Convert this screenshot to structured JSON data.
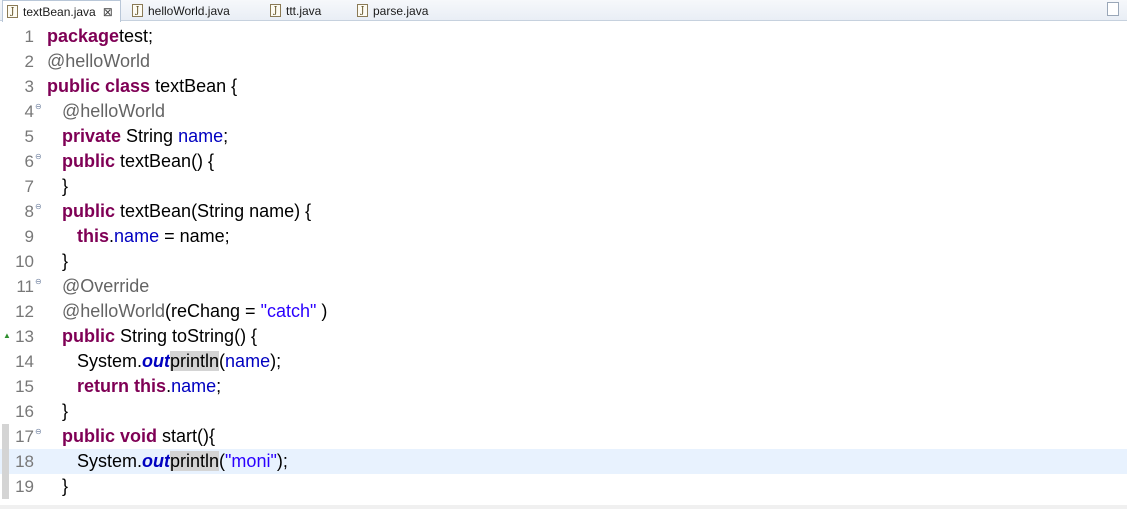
{
  "tabs": [
    {
      "label": "textBean.java",
      "active": true,
      "close": "⊠"
    },
    {
      "label": "helloWorld.java"
    },
    {
      "label": "ttt.java"
    },
    {
      "label": "parse.java"
    }
  ],
  "lines": [
    {
      "n": "1",
      "tokens": [
        [
          "kw",
          "package"
        ],
        [
          "",
          "test;"
        ]
      ]
    },
    {
      "n": "2",
      "tokens": [
        [
          "an",
          "@helloWorld"
        ]
      ]
    },
    {
      "n": "3",
      "tokens": [
        [
          "kw",
          "public"
        ],
        [
          "",
          " "
        ],
        [
          "kw",
          "class"
        ],
        [
          "",
          " textBean {"
        ]
      ]
    },
    {
      "n": "4",
      "fold": true,
      "tokens": [
        [
          "",
          "   "
        ],
        [
          "an",
          "@helloWorld"
        ]
      ]
    },
    {
      "n": "5",
      "tokens": [
        [
          "",
          "   "
        ],
        [
          "kw",
          "private"
        ],
        [
          "",
          " String "
        ],
        [
          "fld",
          "name"
        ],
        [
          "",
          ";"
        ]
      ]
    },
    {
      "n": "6",
      "fold": true,
      "tokens": [
        [
          "",
          "   "
        ],
        [
          "kw",
          "public"
        ],
        [
          "",
          " textBean() {"
        ]
      ]
    },
    {
      "n": "7",
      "tokens": [
        [
          "",
          "   }"
        ]
      ]
    },
    {
      "n": "8",
      "fold": true,
      "tokens": [
        [
          "",
          "   "
        ],
        [
          "kw",
          "public"
        ],
        [
          "",
          " textBean(String name) {"
        ]
      ]
    },
    {
      "n": "9",
      "tokens": [
        [
          "",
          "      "
        ],
        [
          "kw",
          "this"
        ],
        [
          "",
          "."
        ],
        [
          "fld",
          "name"
        ],
        [
          "",
          " = name;"
        ]
      ]
    },
    {
      "n": "10",
      "tokens": [
        [
          "",
          "   }"
        ]
      ]
    },
    {
      "n": "11",
      "fold": true,
      "tokens": [
        [
          "",
          "   "
        ],
        [
          "an",
          "@Override"
        ]
      ]
    },
    {
      "n": "12",
      "tokens": [
        [
          "",
          "   "
        ],
        [
          "an",
          "@helloWorld"
        ],
        [
          "",
          "(reChang = "
        ],
        [
          "str",
          "\"catch\""
        ],
        [
          "",
          " )"
        ]
      ]
    },
    {
      "n": "13",
      "override": true,
      "tokens": [
        [
          "",
          "   "
        ],
        [
          "kw",
          "public"
        ],
        [
          "",
          " String toString() {"
        ]
      ]
    },
    {
      "n": "14",
      "tokens": [
        [
          "",
          "      System."
        ],
        [
          "sf",
          "out"
        ],
        [
          "occ",
          "println"
        ],
        [
          "",
          "("
        ],
        [
          "fld",
          "name"
        ],
        [
          "",
          ");"
        ]
      ]
    },
    {
      "n": "15",
      "tokens": [
        [
          "",
          "      "
        ],
        [
          "kw",
          "return"
        ],
        [
          "",
          " "
        ],
        [
          "kw",
          "this"
        ],
        [
          "",
          "."
        ],
        [
          "fld",
          "name"
        ],
        [
          "",
          ";"
        ]
      ]
    },
    {
      "n": "16",
      "tokens": [
        [
          "",
          "   }"
        ]
      ]
    },
    {
      "n": "17",
      "fold": true,
      "mark": true,
      "tokens": [
        [
          "",
          "   "
        ],
        [
          "kw",
          "public"
        ],
        [
          "",
          " "
        ],
        [
          "kw",
          "void"
        ],
        [
          "",
          " start(){"
        ]
      ]
    },
    {
      "n": "18",
      "current": true,
      "mark": true,
      "tokens": [
        [
          "",
          "      System."
        ],
        [
          "sf",
          "out"
        ],
        [
          "occ",
          "println"
        ],
        [
          "",
          "("
        ],
        [
          "str",
          "\"moni\""
        ],
        [
          "",
          ");"
        ]
      ]
    },
    {
      "n": "19",
      "mark": true,
      "tokens": [
        [
          "",
          "   }"
        ]
      ]
    }
  ]
}
